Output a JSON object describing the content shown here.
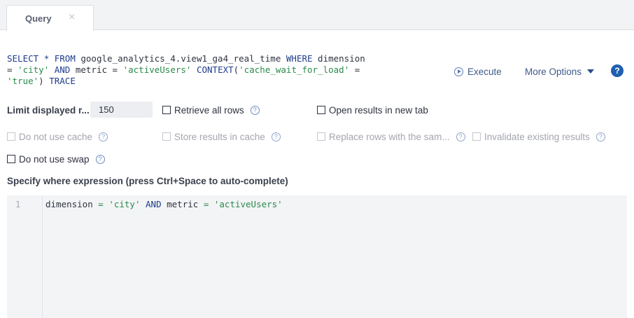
{
  "tab": {
    "label": "Query",
    "close": "×"
  },
  "sql": [
    {
      "t": "SELECT",
      "c": "kw"
    },
    {
      "t": " "
    },
    {
      "t": "*",
      "c": "kw"
    },
    {
      "t": " "
    },
    {
      "t": "FROM",
      "c": "kw"
    },
    {
      "t": " google_analytics_4.view1_ga4_real_time "
    },
    {
      "t": "WHERE",
      "c": "kw"
    },
    {
      "t": " dimension = "
    },
    {
      "t": "'city'",
      "c": "str"
    },
    {
      "t": " "
    },
    {
      "t": "AND",
      "c": "kw"
    },
    {
      "t": " metric = "
    },
    {
      "t": "'activeUsers'",
      "c": "str"
    },
    {
      "t": " "
    },
    {
      "t": "CONTEXT",
      "c": "kw"
    },
    {
      "t": "("
    },
    {
      "t": "'cache_wait_for_load'",
      "c": "str"
    },
    {
      "t": " = "
    },
    {
      "t": "'true'",
      "c": "str"
    },
    {
      "t": ") "
    },
    {
      "t": "TRACE",
      "c": "kw"
    }
  ],
  "actions": {
    "execute": "Execute",
    "more_options": "More Options",
    "help": "?"
  },
  "options": {
    "limit_label": "Limit displayed r...",
    "limit_value": "150",
    "retrieve_all": "Retrieve all rows",
    "open_new_tab": "Open results in new tab",
    "no_cache": "Do not use cache",
    "store_cache": "Store results in cache",
    "replace_rows": "Replace rows with the sam...",
    "invalidate": "Invalidate existing results",
    "no_swap": "Do not use swap",
    "help_glyph": "?"
  },
  "where": {
    "title": "Specify where expression (press Ctrl+Space to auto-complete)",
    "line_number": "1",
    "code": [
      {
        "t": "dimension "
      },
      {
        "t": "=",
        "c": "op"
      },
      {
        "t": " "
      },
      {
        "t": "'city'",
        "c": "str"
      },
      {
        "t": " "
      },
      {
        "t": "AND",
        "c": "kw"
      },
      {
        "t": " metric "
      },
      {
        "t": "=",
        "c": "op"
      },
      {
        "t": " "
      },
      {
        "t": "'activeUsers'",
        "c": "str"
      }
    ]
  }
}
